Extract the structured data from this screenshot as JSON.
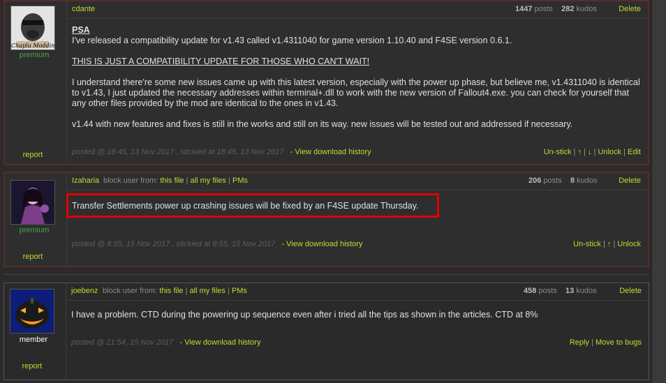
{
  "posts": [
    {
      "author": "cdante",
      "rank": "premium",
      "posts_count": "1447",
      "posts_label": "posts",
      "kudos_count": "282",
      "kudos_label": "kudos",
      "delete": "Delete",
      "report": "report",
      "avatar_caption": "Chaplu Modding",
      "content": {
        "title": "PSA",
        "line1": "I've released a compatibility update for v1.43 called v1.4311040 for game version 1.10.40 and F4SE version 0.6.1.",
        "caps": "THIS IS JUST A COMPATIBILITY UPDATE FOR THOSE WHO CAN'T WAIT!",
        "para": "I understand there're some new issues came up with this latest version, especially with the power up phase, but believe me, v1.4311040 is identical to v1.43, I just updated the necessary addresses within terminal+.dll to work with the new version of Fallout4.exe. you can check for yourself that any other files provided by the mod are identical to the ones in v1.43.",
        "last": "v1.44 with new features and fixes is still in the works and still on its way. new issues will be tested out and addressed if necessary."
      },
      "meta": "posted @ 18:45, 13 Nov 2017 , stickied at 18:45, 13 Nov 2017",
      "history": "- View download history",
      "actions": [
        "Un-stick",
        "↑",
        "↓",
        "Unlock",
        "Edit"
      ]
    },
    {
      "author": "Izaharia",
      "rank": "premium",
      "block_label": "block user from:",
      "block_links": [
        "this file",
        "all my files",
        "PMs"
      ],
      "posts_count": "206",
      "posts_label": "posts",
      "kudos_count": "8",
      "kudos_label": "kudos",
      "delete": "Delete",
      "report": "report",
      "content": "Transfer Settlements power up crashing issues will be fixed by an F4SE update Thursday.",
      "meta": "posted @ 8:55, 15 Nov 2017 , stickied at 8:55, 15 Nov 2017",
      "history": "- View download history",
      "actions": [
        "Un-stick",
        "↑",
        "Unlock"
      ]
    },
    {
      "author": "joebenz",
      "rank": "member",
      "block_label": "block user from:",
      "block_links": [
        "this file",
        "all my files",
        "PMs"
      ],
      "posts_count": "458",
      "posts_label": "posts",
      "kudos_count": "13",
      "kudos_label": "kudos",
      "delete": "Delete",
      "report": "report",
      "content": "I have a problem. CTD during the powering up sequence even after i tried all the tips as shown in the articles. CTD at 8%",
      "meta": "posted @ 21:54, 15 Nov 2017",
      "history": "- View download history",
      "actions": [
        "Reply",
        "Move to bugs"
      ]
    }
  ],
  "colors": {
    "accent": "#c7d932",
    "premium": "#4ba54b",
    "highlight": "#e00000",
    "background": "#2b2b2b"
  }
}
